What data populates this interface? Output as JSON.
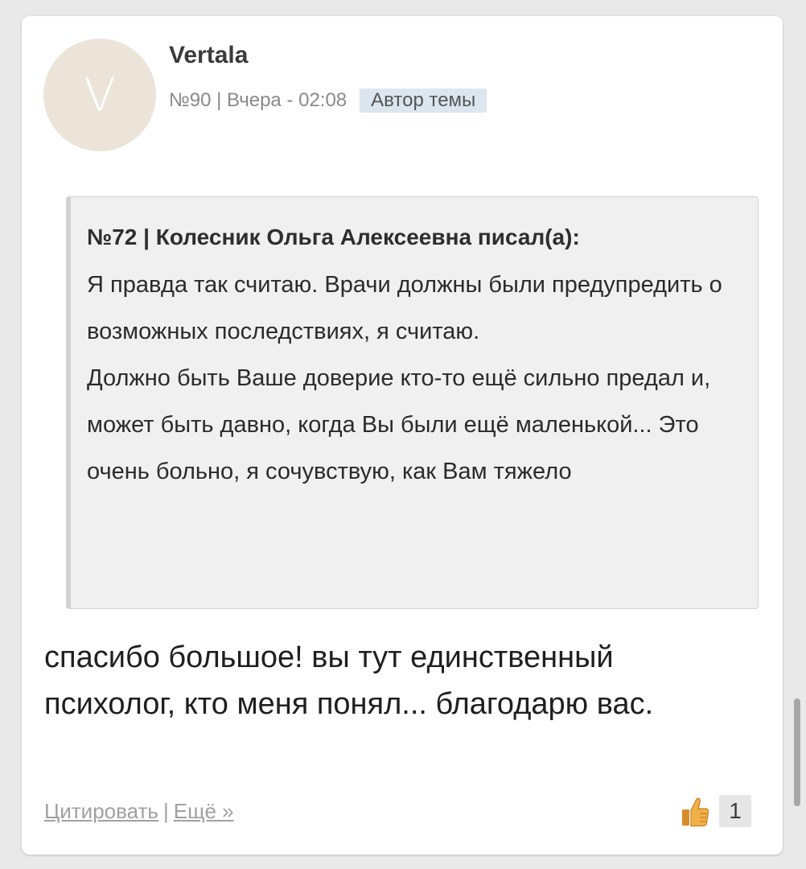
{
  "post": {
    "avatar_letter": "V",
    "username": "Vertala",
    "meta": "№90 | Вчера - 02:08",
    "badge": "Автор темы",
    "quote": {
      "header": "№72 | Колесник Ольга Алексеевна писал(а):",
      "paragraph_1": "Я правда так считаю. Врачи должны были предупредить о возможных последствиях, я считаю.",
      "paragraph_2": "Должно быть Ваше доверие кто-то ещё сильно предал и, может быть давно, когда Вы были ещё маленькой... Это очень больно, я сочувствую, как Вам тяжело"
    },
    "message": "спасибо большое! вы тут единственный психолог, кто меня понял... благодарю вас.",
    "actions": {
      "quote_link": "Цитировать",
      "separator": "|",
      "more_link": "Ещё »"
    },
    "like": {
      "icon": "thumbs-up-icon",
      "count": "1"
    }
  },
  "colors": {
    "background": "#e9e9e9",
    "card": "#ffffff",
    "avatar_bg": "#ece4d9",
    "badge_bg": "#dce6ee",
    "quote_bg": "#f0f0f0",
    "link": "#a0a0a0",
    "thumb": "#e8a33b"
  }
}
